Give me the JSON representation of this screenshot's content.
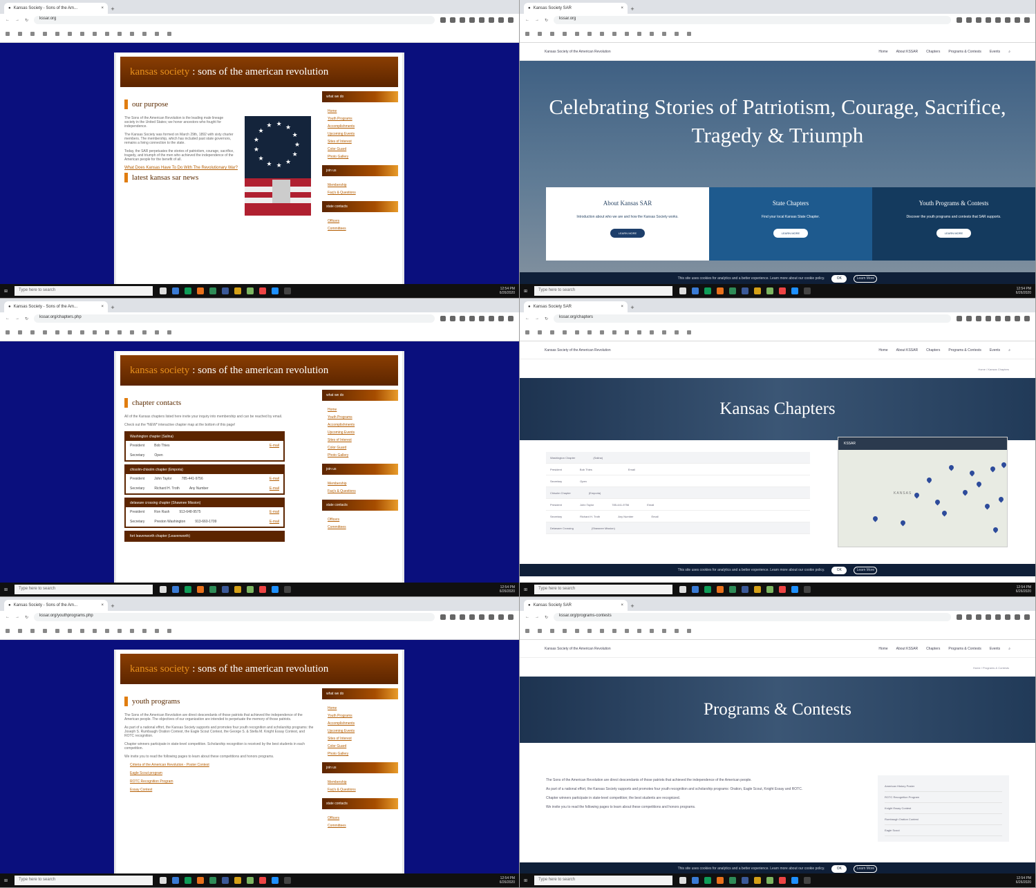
{
  "old_site": {
    "tab_title": "Kansas Society - Sons of the Am...",
    "urls": [
      "kssar.org",
      "kssar.org/chapters.php",
      "kssar.org/youthprograms.php"
    ],
    "banner_hl": "kansas society",
    "banner_rest": ": sons of the american revolution",
    "sidebar": {
      "what_we_do": "what we do",
      "join_us": "join us",
      "state_contacts": "state contacts",
      "links": [
        "Home",
        "Youth Programs",
        "Accomplishments",
        "Upcoming Events",
        "Sites of Interest",
        "Color Guard",
        "Photo Gallery"
      ],
      "join_links": [
        "Membership",
        "Faq's & Questions"
      ],
      "contact_links": [
        "Officers",
        "Committees"
      ]
    },
    "purpose": {
      "title": "our purpose",
      "paragraphs": [
        "The Sons of the American Revolution is the leading male lineage society in the United States; we honor ancestors who fought for independence.",
        "The Kansas Society was formed on March 29th, 1892 with sixty charter members. The membership, which has included past state governors, remains a living connection to the state.",
        "Today, the SAR perpetuates the stories of patriotism, courage, sacrifice, tragedy, and triumph of the men who achieved the independence of the American people for the benefit of all."
      ],
      "link": "What Does Kansas Have To Do With The Revolutionary War?",
      "news": "latest kansas sar news"
    },
    "chapters": {
      "title": "chapter contacts",
      "intro": "All of the Kansas chapters listed here invite your inquiry into membership and can be reached by email.",
      "map_note": "Check out the *NEW* interactive chapter map at the bottom of this page!",
      "groups": [
        {
          "name": "Washington chapter (Salina)",
          "rows": [
            {
              "role": "President",
              "name": "Bob Thies",
              "phone": "",
              "email": "E-mail"
            },
            {
              "role": "Secretary",
              "name": "Open",
              "phone": "",
              "email": ""
            }
          ]
        },
        {
          "name": "chisolm-chisolm chapter (Emporia)",
          "rows": [
            {
              "role": "President",
              "name": "John Taylor",
              "phone": "785-441-9756",
              "email": "E-mail"
            },
            {
              "role": "Secretary",
              "name": "Richard H. Troth",
              "phone": "Any Number",
              "email": "E-mail"
            }
          ]
        },
        {
          "name": "delaware crossing chapter (Shawnee Mission)",
          "rows": [
            {
              "role": "President",
              "name": "Ron Rash",
              "phone": "913-648-9575",
              "email": "E-mail"
            },
            {
              "role": "Secretary",
              "name": "Preston Washington",
              "phone": "913-660-1709",
              "email": "E-mail"
            }
          ]
        },
        {
          "name": "fort leavenworth chapter (Leavenworth)",
          "rows": []
        }
      ]
    },
    "youth": {
      "title": "youth programs",
      "paragraphs": [
        "The Sons of the American Revolution are direct descendants of those patriots that achieved the independence of the American people. The objectives of our organization are intended to perpetuate the memory of those patriots.",
        "As part of a national effort, the Kansas Society supports and promotes four youth recognition and scholarship programs: the Joseph S. Rumbaugh Oration Contest, the Eagle Scout Contest, the George S. & Stella M. Knight Essay Contest, and ROTC recognition.",
        "Chapter winners participate in state-level competition. Scholarship recognition is received by the best students in each competition.",
        "We invite you to read the following pages to learn about these competitions and honors programs."
      ],
      "bullets": [
        "Criteria of the American Revolution - Poster Contest",
        "Eagle Scout program",
        "ROTC Recognition Program",
        "Essay Contest"
      ]
    }
  },
  "new_site": {
    "tab_title": "Kansas Society SAR",
    "urls": [
      "kssar.org",
      "kssar.org/chapters",
      "kssar.org/programs-contests"
    ],
    "site_name": "Kansas Society of the American Revolution",
    "nav": [
      "Home",
      "About KSSAR",
      "Chapters",
      "Programs & Contests",
      "Events"
    ],
    "hero_title": "Celebrating Stories of Patriotism, Courage, Sacrifice, Tragedy & Triumph",
    "boxes": [
      {
        "title": "About Kansas SAR",
        "text": "Introduction about who we are and how the Kansas Society works.",
        "btn": "LEARN MORE"
      },
      {
        "title": "State Chapters",
        "text": "Find your local Kansas State Chapter.",
        "btn": "LEARN MORE"
      },
      {
        "title": "Youth Programs & Contests",
        "text": "Discover the youth programs and contests that SAR supports.",
        "btn": "LEARN MORE"
      }
    ],
    "cookie_text": "This site uses cookies for analytics and a better experience. Learn more about our cookie policy.",
    "cookie_ok": "OK",
    "cookie_more": "Learn More",
    "chapters_title": "Kansas Chapters",
    "chapters_crumb": "Home / Kansas Chapters",
    "map_title": "KSSAR",
    "map_state": "KANSAS",
    "table": [
      {
        "a": "Washington Chapter",
        "b": "(Salina)",
        "c": "",
        "d": ""
      },
      {
        "a": "President",
        "b": "Bob Thies",
        "c": "",
        "d": "Email"
      },
      {
        "a": "Secretary",
        "b": "Open",
        "c": "",
        "d": ""
      },
      {
        "a": "Chisolm Chapter",
        "b": "(Emporia)",
        "c": "",
        "d": ""
      },
      {
        "a": "President",
        "b": "John Taylor",
        "c": "785-441-9756",
        "d": "Email"
      },
      {
        "a": "Secretary",
        "b": "Richard H. Troth",
        "c": "Any Number",
        "d": "Email"
      },
      {
        "a": "Delaware Crossing",
        "b": "(Shawnee Mission)",
        "c": "",
        "d": ""
      }
    ],
    "programs_title": "Programs & Contests",
    "programs_crumb": "Home / Programs & Contests",
    "programs_text": [
      "The Sons of the American Revolution are direct descendants of those patriots that achieved the independence of the American people.",
      "As part of a national effort, the Kansas Society supports and promotes four youth recognition and scholarship programs: Oration, Eagle Scout, Knight Essay and ROTC.",
      "Chapter winners participate in state-level competition; the best students are recognized.",
      "We invite you to read the following pages to learn about these competitions and honors programs."
    ],
    "programs_side": [
      "American History Poster",
      "ROTC Recognition Program",
      "Knight Essay Contest",
      "Rumbaugh Oration Contest",
      "Eagle Scout"
    ]
  },
  "taskbar": {
    "search": "Type here to search",
    "time": "12:54 PM",
    "date": "6/26/2020"
  }
}
